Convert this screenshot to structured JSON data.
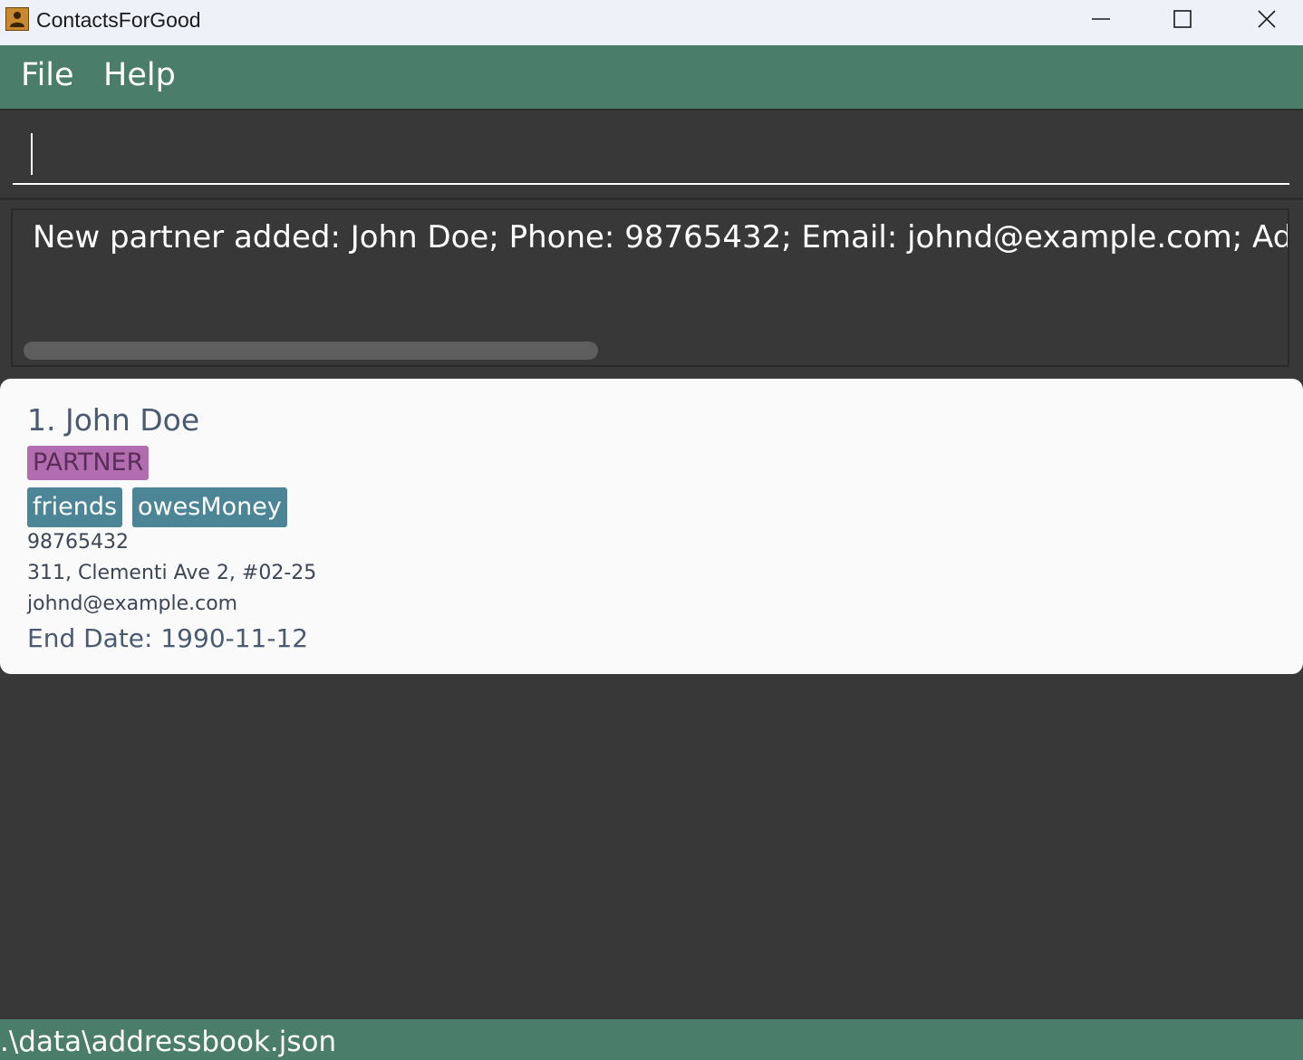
{
  "window": {
    "title": "ContactsForGood",
    "icon": "contacts-app-icon",
    "controls": [
      "minimize-icon",
      "maximize-icon",
      "close-icon"
    ]
  },
  "menu": {
    "items": [
      {
        "label": "File"
      },
      {
        "label": "Help"
      }
    ]
  },
  "command_box": {
    "value": "",
    "placeholder": ""
  },
  "result_display": {
    "text": "New partner added: John Doe; Phone: 98765432; Email: johnd@example.com; Addre"
  },
  "person_list": [
    {
      "index_name": "1. John Doe",
      "role": "PARTNER",
      "tags": [
        "friends",
        "owesMoney"
      ],
      "phone": "98765432",
      "address": "311, Clementi Ave 2, #02-25",
      "email": "johnd@example.com",
      "end_date": "End Date: 1990-11-12"
    }
  ],
  "status_bar": {
    "path": ".\\data\\addressbook.json"
  },
  "colors": {
    "accent_green": "#4a7d6a",
    "background_dark": "#383838",
    "role_badge": "#b26db0",
    "tag": "#4b8596",
    "card": "#fafafa"
  }
}
